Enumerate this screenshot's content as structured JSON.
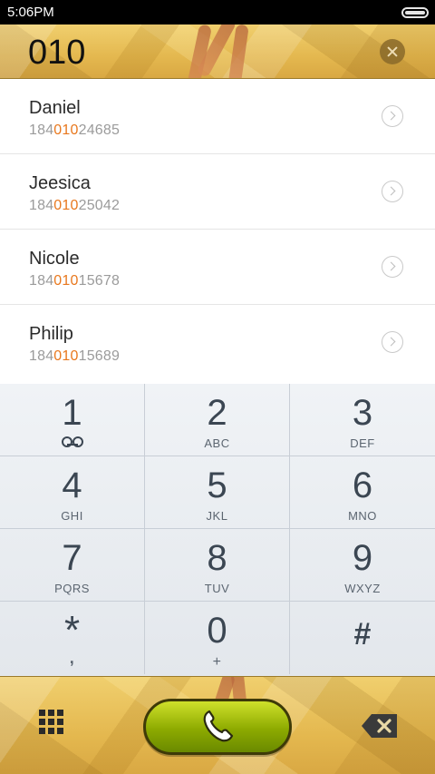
{
  "status_bar": {
    "time": "5:06PM"
  },
  "search": {
    "query": "010",
    "clear_icon": "close-circle-icon"
  },
  "results": [
    {
      "name": "Daniel",
      "number_prefix": "184",
      "number_match": "010",
      "number_suffix": "24685"
    },
    {
      "name": "Jeesica",
      "number_prefix": "184",
      "number_match": "010",
      "number_suffix": "25042"
    },
    {
      "name": "Nicole",
      "number_prefix": "184",
      "number_match": "010",
      "number_suffix": "15678"
    },
    {
      "name": "Philip",
      "number_prefix": "184",
      "number_match": "010",
      "number_suffix": "15689"
    }
  ],
  "keypad": {
    "keys": [
      {
        "digit": "1",
        "letters": "",
        "icon": "voicemail-icon"
      },
      {
        "digit": "2",
        "letters": "ABC"
      },
      {
        "digit": "3",
        "letters": "DEF"
      },
      {
        "digit": "4",
        "letters": "GHI"
      },
      {
        "digit": "5",
        "letters": "JKL"
      },
      {
        "digit": "6",
        "letters": "MNO"
      },
      {
        "digit": "7",
        "letters": "PQRS"
      },
      {
        "digit": "8",
        "letters": "TUV"
      },
      {
        "digit": "9",
        "letters": "WXYZ"
      },
      {
        "digit": "*",
        "letters": ","
      },
      {
        "digit": "0",
        "letters": "+"
      },
      {
        "digit": "#",
        "letters": ""
      }
    ]
  },
  "bottom_bar": {
    "dialpad_icon": "dialpad-grid-icon",
    "call_icon": "phone-icon",
    "backspace_icon": "backspace-icon"
  },
  "colors": {
    "match_highlight": "#e8781e",
    "call_button": "#8daa00",
    "header_bg": "#e4b84f"
  }
}
